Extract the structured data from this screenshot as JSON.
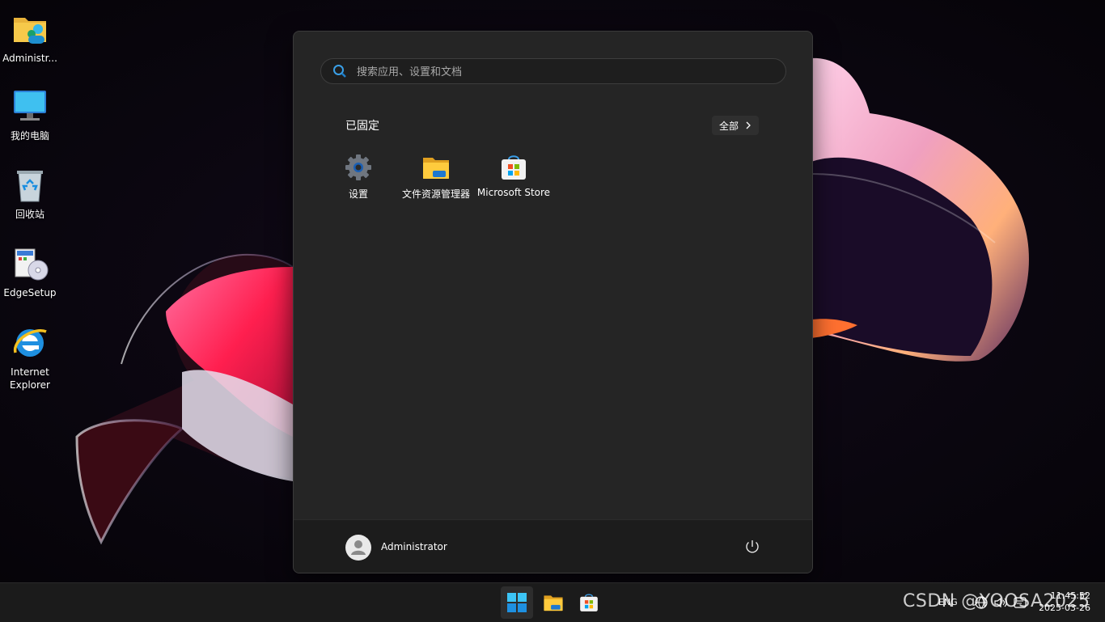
{
  "desktop": {
    "icons": [
      {
        "label": "Administr...",
        "icon": "user-folder-icon"
      },
      {
        "label": "我的电脑",
        "icon": "computer-icon"
      },
      {
        "label": "回收站",
        "icon": "recycle-bin-icon"
      },
      {
        "label": "EdgeSetup",
        "icon": "installer-icon"
      },
      {
        "label_line1": "Internet",
        "label_line2": "Explorer",
        "icon": "internet-explorer-icon"
      }
    ]
  },
  "start_menu": {
    "search_placeholder": "搜索应用、设置和文档",
    "pinned_title": "已固定",
    "all_button": "全部",
    "pinned_apps": [
      {
        "label": "设置",
        "icon": "settings-gear-icon"
      },
      {
        "label": "文件资源管理器",
        "icon": "file-explorer-icon"
      },
      {
        "label": "Microsoft Store",
        "icon": "microsoft-store-icon"
      }
    ],
    "user_name": "Administrator"
  },
  "taskbar": {
    "buttons": [
      "start-icon",
      "file-explorer-icon",
      "microsoft-store-icon"
    ],
    "language": "ENG",
    "time": "11:45:52",
    "date": "2025-03-26"
  },
  "watermark": "CSDN @YOOSA2025",
  "colors": {
    "accent": "#0078d4",
    "menu_bg": "#252525",
    "taskbar_bg": "#1b1b1b"
  }
}
